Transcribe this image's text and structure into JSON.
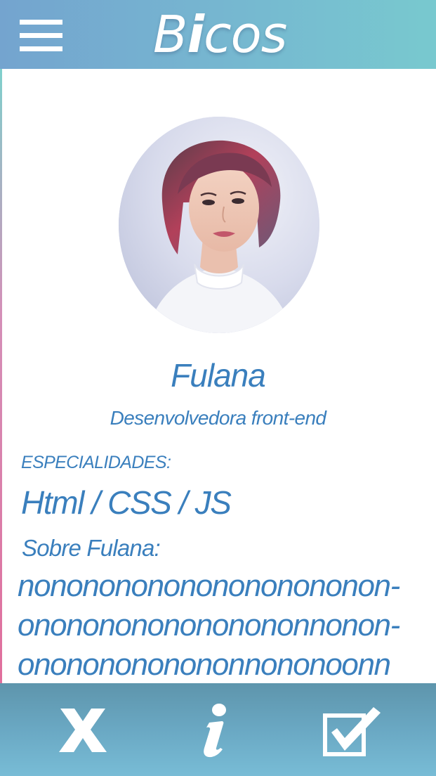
{
  "app": {
    "brand_parts": [
      "B",
      "i",
      "cos"
    ]
  },
  "profile": {
    "name": "Fulana",
    "role": "Desenvolvedora front-end",
    "specialties_label": "ESPECIALIDADES:",
    "specialties": "Html / CSS / JS",
    "about_label": "Sobre Fulana:",
    "about_lines": [
      "nononononononononononon-",
      "onononononononononnonon-",
      "onononononononnononoonn"
    ]
  },
  "icons": {
    "menu": "hamburger-menu-icon",
    "reject": "x-icon",
    "info": "info-icon",
    "accept": "checkbox-check-icon"
  },
  "colors": {
    "topbar_start": "#74a4cf",
    "topbar_end": "#78c9cf",
    "text_accent": "#3a7fbd",
    "actionbar": "#6aa8c3"
  }
}
